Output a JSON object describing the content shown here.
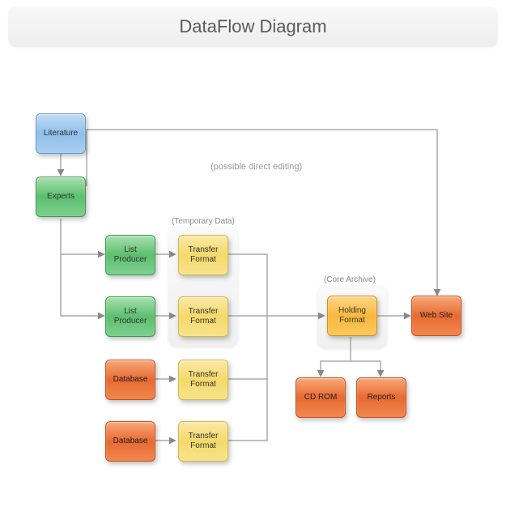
{
  "title": "DataFlow Diagram",
  "annotations": {
    "possible_direct_editing": "(possible direct editing)"
  },
  "groups": {
    "temporary_data": {
      "label": "(Temporary Data)"
    },
    "core_archive": {
      "label": "(Core Archive)"
    }
  },
  "nodes": {
    "literature": {
      "label": "Literature"
    },
    "experts": {
      "label": "Experts"
    },
    "list_producer_1": {
      "label": "List Producer"
    },
    "list_producer_2": {
      "label": "List Producer"
    },
    "transfer_format_1": {
      "label": "Transfer Format"
    },
    "transfer_format_2": {
      "label": "Transfer Format"
    },
    "database_1": {
      "label": "Database"
    },
    "database_2": {
      "label": "Database"
    },
    "transfer_format_3": {
      "label": "Transfer Format"
    },
    "transfer_format_4": {
      "label": "Transfer Format"
    },
    "holding_format": {
      "label": "Holding Format"
    },
    "web_site": {
      "label": "Web Site"
    },
    "cd_rom": {
      "label": "CD ROM"
    },
    "reports": {
      "label": "Reports"
    }
  }
}
